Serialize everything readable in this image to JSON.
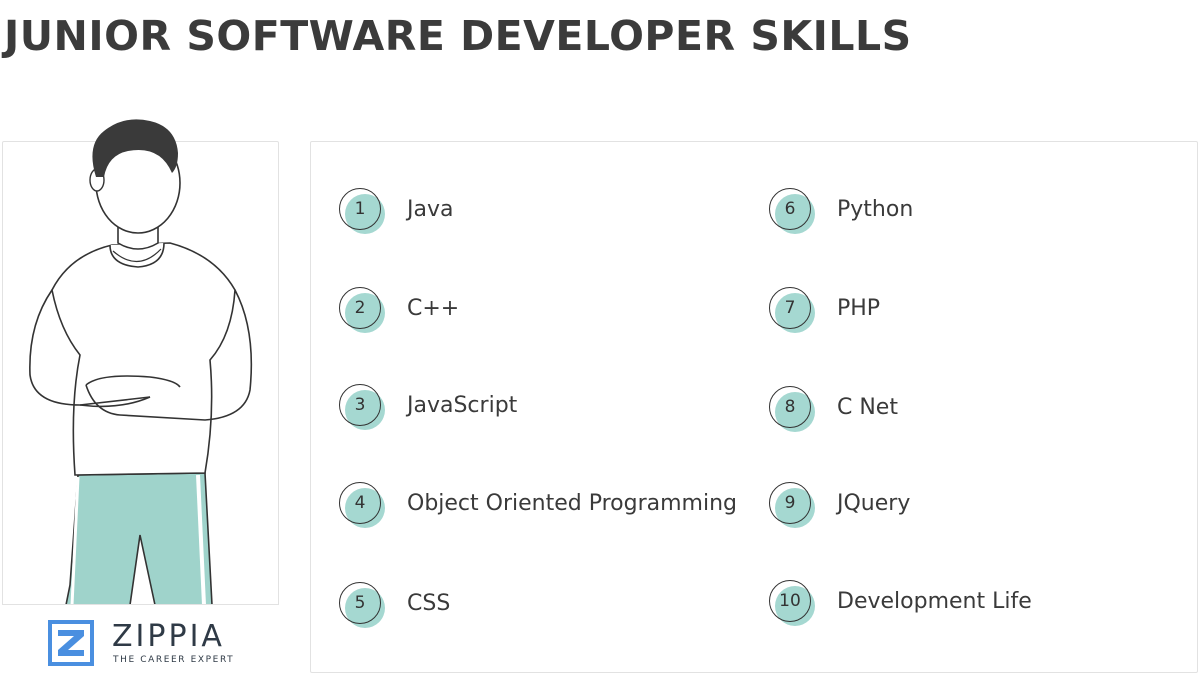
{
  "title": "JUNIOR SOFTWARE DEVELOPER SKILLS",
  "brand": {
    "name": "ZIPPIA",
    "tagline": "THE CAREER EXPERT",
    "accent_color": "#4a8fe0"
  },
  "badge_color": "#a5d8d1",
  "skills_left": [
    {
      "num": "1",
      "label": "Java"
    },
    {
      "num": "2",
      "label": "C++"
    },
    {
      "num": "3",
      "label": "JavaScript"
    },
    {
      "num": "4",
      "label": "Object Oriented Programming"
    },
    {
      "num": "5",
      "label": "CSS"
    }
  ],
  "skills_right": [
    {
      "num": "6",
      "label": "Python"
    },
    {
      "num": "7",
      "label": "PHP"
    },
    {
      "num": "8",
      "label": "C Net"
    },
    {
      "num": "9",
      "label": "JQuery"
    },
    {
      "num": "10",
      "label": "Development Life"
    }
  ]
}
